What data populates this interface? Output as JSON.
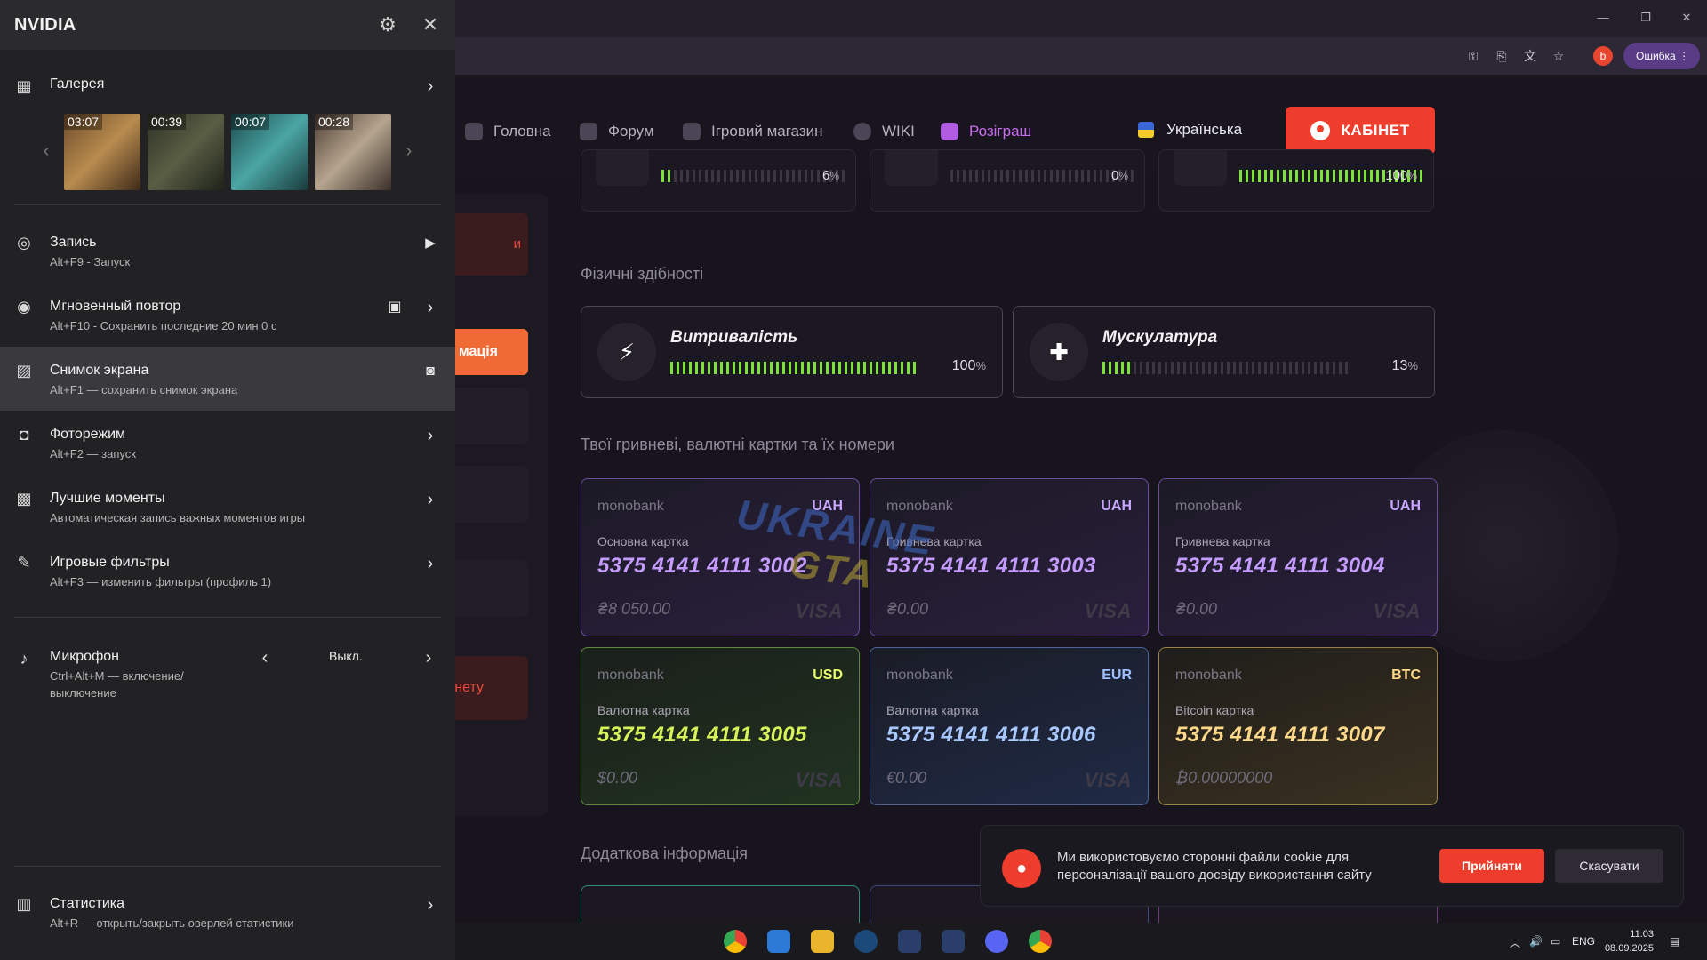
{
  "window_controls": {
    "minimize": "—",
    "maximize": "❐",
    "close": "✕"
  },
  "browser": {
    "profile_letter": "b",
    "error_label": "Ошибка"
  },
  "site": {
    "nav": [
      {
        "label": "Головна"
      },
      {
        "label": "Форум"
      },
      {
        "label": "Ігровий магазин"
      },
      {
        "label": "WIKI"
      },
      {
        "label": "Розіграш"
      }
    ],
    "language": "Українська",
    "cabinet_button": "КАБІНЕТ",
    "sidebar": {
      "orange_button": "мація",
      "red_button": "нету",
      "red_top": "и"
    },
    "stats_top": [
      {
        "pct": "6",
        "filled": 0.06,
        "unit": "%"
      },
      {
        "pct": "0",
        "filled": 0.0,
        "unit": "%"
      },
      {
        "pct": "100",
        "filled": 1.0,
        "unit": "%"
      }
    ],
    "physical_title": "Фізичні здібності",
    "abilities": [
      {
        "name": "Витривалість",
        "pct": "100",
        "filled": 1.0,
        "unit": "%"
      },
      {
        "name": "Мускулатура",
        "pct": "13",
        "filled": 0.13,
        "unit": "%"
      }
    ],
    "cards_title": "Твої гривневі, валютні картки та їх номери",
    "cards": [
      {
        "bank": "monobank",
        "currency": "UAH",
        "type": "Основна картка",
        "number": "5375 4141 4111 3002",
        "balance": "₴8 050.00",
        "brand": "VISA",
        "style": "uah"
      },
      {
        "bank": "monobank",
        "currency": "UAH",
        "type": "Гривнева картка",
        "number": "5375 4141 4111 3003",
        "balance": "₴0.00",
        "brand": "VISA",
        "style": "uah"
      },
      {
        "bank": "monobank",
        "currency": "UAH",
        "type": "Гривнева картка",
        "number": "5375 4141 4111 3004",
        "balance": "₴0.00",
        "brand": "VISA",
        "style": "uah"
      },
      {
        "bank": "monobank",
        "currency": "USD",
        "type": "Валютна картка",
        "number": "5375 4141 4111 3005",
        "balance": "$0.00",
        "brand": "VISA",
        "style": "usd"
      },
      {
        "bank": "monobank",
        "currency": "EUR",
        "type": "Валютна картка",
        "number": "5375 4141 4111 3006",
        "balance": "€0.00",
        "brand": "VISA",
        "style": "eur"
      },
      {
        "bank": "monobank",
        "currency": "BTC",
        "type": "Bitcoin картка",
        "number": "5375 4141 4111 3007",
        "balance": "₿0.00000000",
        "brand": "",
        "style": "btc"
      }
    ],
    "extra_title": "Додаткова інформація",
    "watermark": {
      "line1": "UKRAINE",
      "line2": "GTA"
    },
    "cookie": {
      "text": "Ми використовуємо сторонні файли cookie для персоналізації вашого досвіду використання сайту",
      "accept": "Прийняти",
      "cancel": "Скасувати"
    }
  },
  "nvidia": {
    "title": "NVIDIA",
    "gallery": {
      "label": "Галерея",
      "thumbs": [
        "03:07",
        "00:39",
        "00:07",
        "00:28"
      ]
    },
    "items": [
      {
        "id": "record",
        "label": "Запись",
        "sub": "Alt+F9 - Запуск"
      },
      {
        "id": "instant-replay",
        "label": "Мгновенный повтор",
        "sub": "Alt+F10 - Сохранить последние 20 мин 0 с"
      },
      {
        "id": "screenshot",
        "label": "Снимок экрана",
        "sub": "Alt+F1 — сохранить снимок экрана"
      },
      {
        "id": "photo-mode",
        "label": "Фоторежим",
        "sub": "Alt+F2 — запуск"
      },
      {
        "id": "highlights",
        "label": "Лучшие моменты",
        "sub": "Автоматическая запись важных моментов игры"
      },
      {
        "id": "game-filters",
        "label": "Игровые фильтры",
        "sub": "Alt+F3 — изменить фильтры (профиль 1)"
      }
    ],
    "microphone": {
      "label": "Микрофон",
      "sub1": "Ctrl+Alt+M — включение/",
      "sub2": "выключение",
      "value": "Выкл."
    },
    "stats": {
      "label": "Статистика",
      "sub": "Alt+R — открыть/закрыть оверлей статистики"
    }
  },
  "taskbar": {
    "lang": "ENG",
    "time": "11:03",
    "date": "08.09.2025"
  }
}
